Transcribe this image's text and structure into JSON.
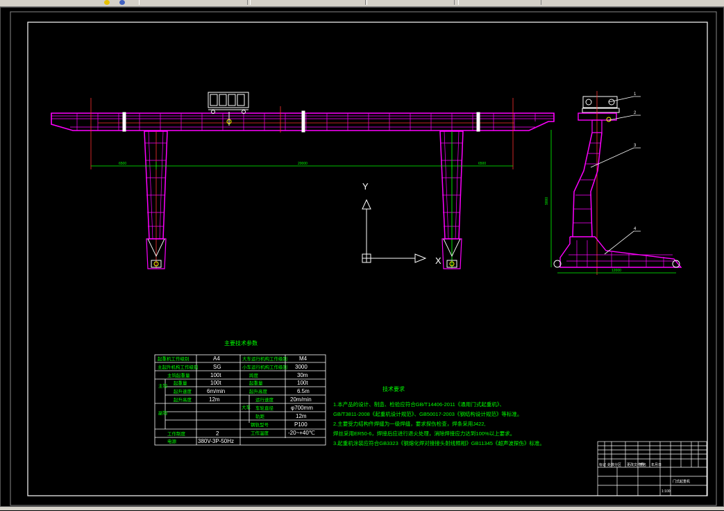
{
  "app": {
    "toolbar_icons": [
      "warning-icon",
      "gear-icon"
    ]
  },
  "drawing": {
    "dimensions": {
      "left_cantilever": "6500",
      "span": "20000",
      "right_cantilever": "6500",
      "side_height": "9000",
      "side_base": "12000"
    },
    "balloons": [
      "1",
      "2",
      "3",
      "4"
    ],
    "axis": {
      "x": "X",
      "y": "Y"
    }
  },
  "param_table": {
    "title": "主要技术参数",
    "left_rows": [
      {
        "label": "起重机工作级别",
        "value": "A4"
      },
      {
        "label": "主起升机构工作级别",
        "value": "SG"
      },
      {
        "label": "主钩起重量",
        "value": "100t"
      },
      {
        "label": "起重量",
        "value": "100t"
      },
      {
        "label": "起升速度",
        "value": "6m/min"
      },
      {
        "label": "起升高度",
        "value": "12m"
      },
      {
        "label": "",
        "value": ""
      },
      {
        "label": "",
        "value": ""
      },
      {
        "label": "",
        "value": ""
      },
      {
        "label": "工作制度",
        "value": ""
      },
      {
        "label": "电源",
        "value": "380V-3P-50Hz"
      }
    ],
    "right_rows": [
      {
        "label": "大车运行机构工作级别",
        "value": "M4"
      },
      {
        "label": "小车运行机构工作级别",
        "value": "3000"
      },
      {
        "label": "跨度",
        "value": "30m"
      },
      {
        "label": "起重量",
        "value": "100t"
      },
      {
        "label": "起升高度",
        "value": "6.5m"
      },
      {
        "label": "运行速度",
        "value": "20m/min"
      },
      {
        "label": "车轮直径",
        "value": "φ700mm"
      },
      {
        "label": "轨距",
        "value": "12m"
      },
      {
        "label": "钢轨型号",
        "value": "P100"
      },
      {
        "label": "工作温度",
        "value": "-20~+40℃"
      }
    ],
    "group_marks": [
      "主钩",
      "副钩",
      "大车"
    ],
    "work_mode": "2"
  },
  "requirements": {
    "title": "技术要求",
    "lines": [
      "1.本产品的设计、制造、检验应符合GB/T14406-2011《通用门式起重机》、",
      "GB/T3811-2008《起重机设计规范》、GB50017-2003《钢结构设计规范》等标准。",
      "2.主要受力结构件焊缝为一级焊缝，要求探伤检查，焊条采用J422,",
      "焊丝采用ER50-6，焊接后应进行退火处理，消除焊接应力达到100%以上要求。",
      "3.起重机涂装应符合GB3323《钢熔化焊对接接头射线照相》GB11345《超声波探伤》标准。"
    ]
  },
  "title_block": {
    "title": "门式起重机",
    "label_cells": [
      "标记",
      "处数",
      "分区",
      "更改文件号",
      "签名",
      "年月日"
    ],
    "small_note": "1:100"
  },
  "colors": {
    "structure": "#ff00ff",
    "sub_lines": "#ff3030",
    "dimension": "#00ff00",
    "frame": "#ffffff",
    "background": "#000000"
  }
}
